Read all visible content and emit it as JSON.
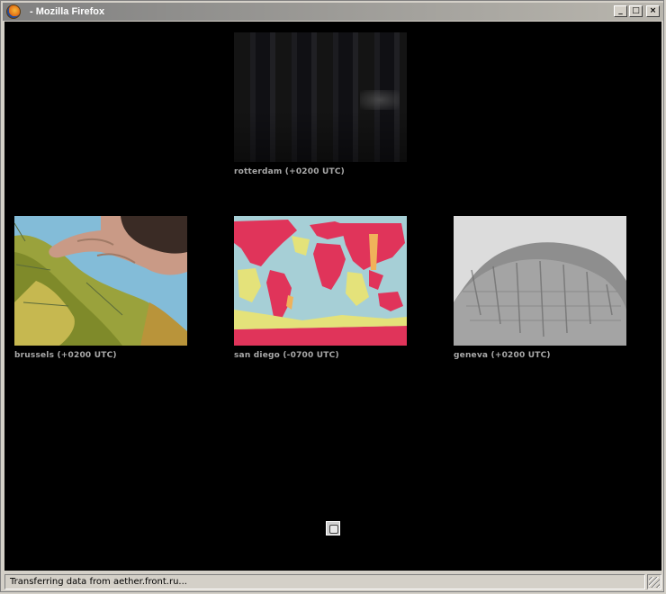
{
  "window": {
    "title": " - Mozilla Firefox",
    "app_icon": "firefox-icon",
    "controls": {
      "minimize": "_",
      "maximize": "□",
      "close": "×"
    }
  },
  "cameras": [
    {
      "id": "rotterdam",
      "label": "rotterdam (+0200 UTC)"
    },
    {
      "id": "brussels",
      "label": "brussels (+0200 UTC)"
    },
    {
      "id": "sandiego",
      "label": "san diego (-0700 UTC)"
    },
    {
      "id": "geneva",
      "label": "geneva (+0200 UTC)"
    }
  ],
  "status_bar": {
    "text": "Transferring data from aether.front.ru..."
  },
  "colors": {
    "page_background": "#000000",
    "label_text": "#a9a9a9",
    "chrome": "#d4d0c8"
  }
}
